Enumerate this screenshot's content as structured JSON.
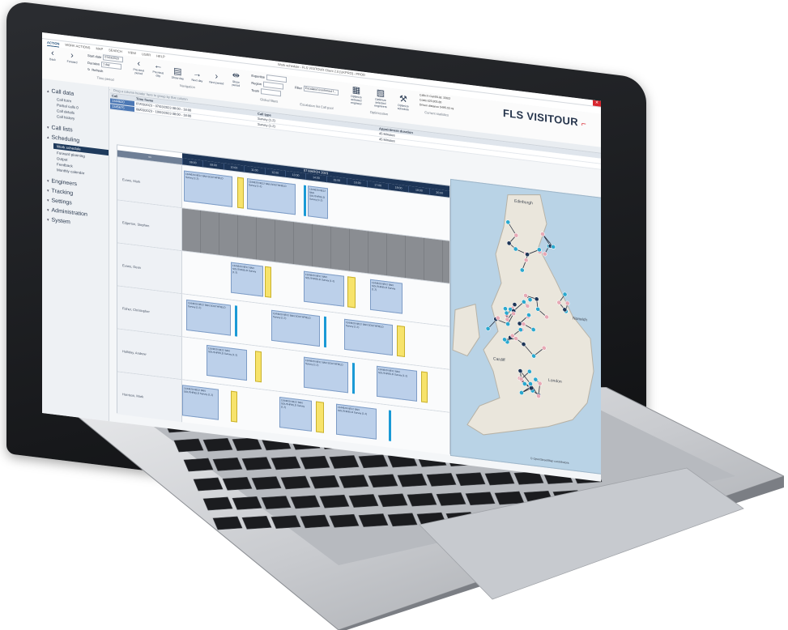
{
  "window": {
    "title": "Work schedule - FLS VISITOUR Client 2.0 [UKPRO] - PROD",
    "close_glyph": "✕"
  },
  "ribbon": {
    "tabs": [
      {
        "label": "ACTION",
        "active": true
      },
      {
        "label": "WORK ACTIONS",
        "active": false
      },
      {
        "label": "MAP",
        "active": false
      },
      {
        "label": "SEARCH",
        "active": false
      },
      {
        "label": "VIEW",
        "active": false
      },
      {
        "label": "USER",
        "active": false
      },
      {
        "label": "HELP",
        "active": false
      }
    ],
    "back_label": "Back",
    "forward_label": "Forward",
    "start_date_label": "Start date",
    "start_date_value": "07/03/2023",
    "duration_label": "Duration",
    "duration_value": "1 day",
    "refresh_label": "Refresh",
    "time_period_caption": "Time period",
    "nav_buttons": [
      {
        "glyph": "‹",
        "label": "Previous period"
      },
      {
        "glyph": "←",
        "label": "Previous day"
      },
      {
        "glyph": "▤",
        "label": "Show day"
      },
      {
        "glyph": "→",
        "label": "Next day"
      },
      {
        "glyph": "›",
        "label": "Next period"
      },
      {
        "glyph": "⇹",
        "label": "Show period"
      }
    ],
    "navigation_caption": "Navigation",
    "filters": [
      {
        "label": "Expertise",
        "value": ""
      },
      {
        "label": "Region",
        "value": ""
      },
      {
        "label": "Team",
        "value": ""
      }
    ],
    "global_filters_caption": "Global filters",
    "escalation_filter_label": "Filter",
    "escalation_filter_value": "Escalated (confirmed f...",
    "escalation_caption": "Escalation list Call pool",
    "opt_buttons": [
      {
        "glyph": "▦",
        "label": "Optimize selected engineer"
      },
      {
        "glyph": "▧",
        "label": "Optimize selected engineers"
      },
      {
        "glyph": "⚒",
        "label": "Optimize schedule"
      }
    ],
    "optimization_caption": "Optimization",
    "stats": [
      "Calls in Gantt/List: 336/2",
      "Costs £20,803.80",
      "Driven distance 5495.02 mi"
    ],
    "current_statistics_caption": "Current statistics",
    "logo_fls": "FLS",
    "logo_visitour": "VISITOUR",
    "logo_mark": "⌐"
  },
  "sidebar": {
    "sections": [
      {
        "label": "Call data",
        "expanded": true,
        "items": [
          "Call form",
          "Partial calls 0",
          "Call details",
          "Call history"
        ]
      },
      {
        "label": "Call lists",
        "expanded": false,
        "items": []
      },
      {
        "label": "Scheduling",
        "expanded": true,
        "items": [
          "Work schedule",
          "Forward planning",
          "Output",
          "Feedback",
          "Monthly calendar"
        ]
      },
      {
        "label": "Engineers",
        "expanded": false,
        "items": []
      },
      {
        "label": "Tracking",
        "expanded": false,
        "items": []
      },
      {
        "label": "Settings",
        "expanded": false,
        "items": []
      },
      {
        "label": "Administration",
        "expanded": false,
        "items": []
      },
      {
        "label": "System",
        "expanded": false,
        "items": []
      }
    ],
    "selected_item": "Work schedule"
  },
  "calls_table": {
    "group_hint": "Drag a column header here to group by that column",
    "columns": [
      "Call",
      "Time frame",
      "Call type",
      "Appointment duration"
    ],
    "rows": [
      {
        "call": "1344620",
        "time_frame": "07/03/2023 - 07/03/2023 08:00 - 18:00",
        "call_type": "Survey (1.2)",
        "duration": "45 Minutes"
      },
      {
        "call": "1345675",
        "time_frame": "08/03/2023 - 10/03/2023 08:00 - 18:00",
        "call_type": "Survey (1.2)",
        "duration": "45 Minutes"
      }
    ]
  },
  "gantt": {
    "date_label": "07 MARCH 2023",
    "corner_glyph": "⇔",
    "hours": [
      "08:00",
      "09:00",
      "10:00",
      "11:00",
      "12:00",
      "13:00",
      "14:00",
      "15:00",
      "16:00",
      "17:00",
      "18:00",
      "19:00",
      "20:00"
    ],
    "engineers": [
      {
        "name": "Evans, Mark",
        "blocked": false
      },
      {
        "name": "Edgerton, Stephen",
        "blocked": true
      },
      {
        "name": "Evans, Dean",
        "blocked": false
      },
      {
        "name": "Fisher, Christopher",
        "blocked": false
      },
      {
        "name": "Halliday, Andrew",
        "blocked": false
      },
      {
        "name": "Harrison, Mark",
        "blocked": false
      }
    ],
    "job_text": "1344620 NE12 8AN SOUTHFIELD Survey (1.2)"
  },
  "map": {
    "labels": [
      "Edinburgh",
      "Norwich",
      "Cardiff",
      "London"
    ],
    "attribution": "© OpenStreetMap contributors"
  }
}
